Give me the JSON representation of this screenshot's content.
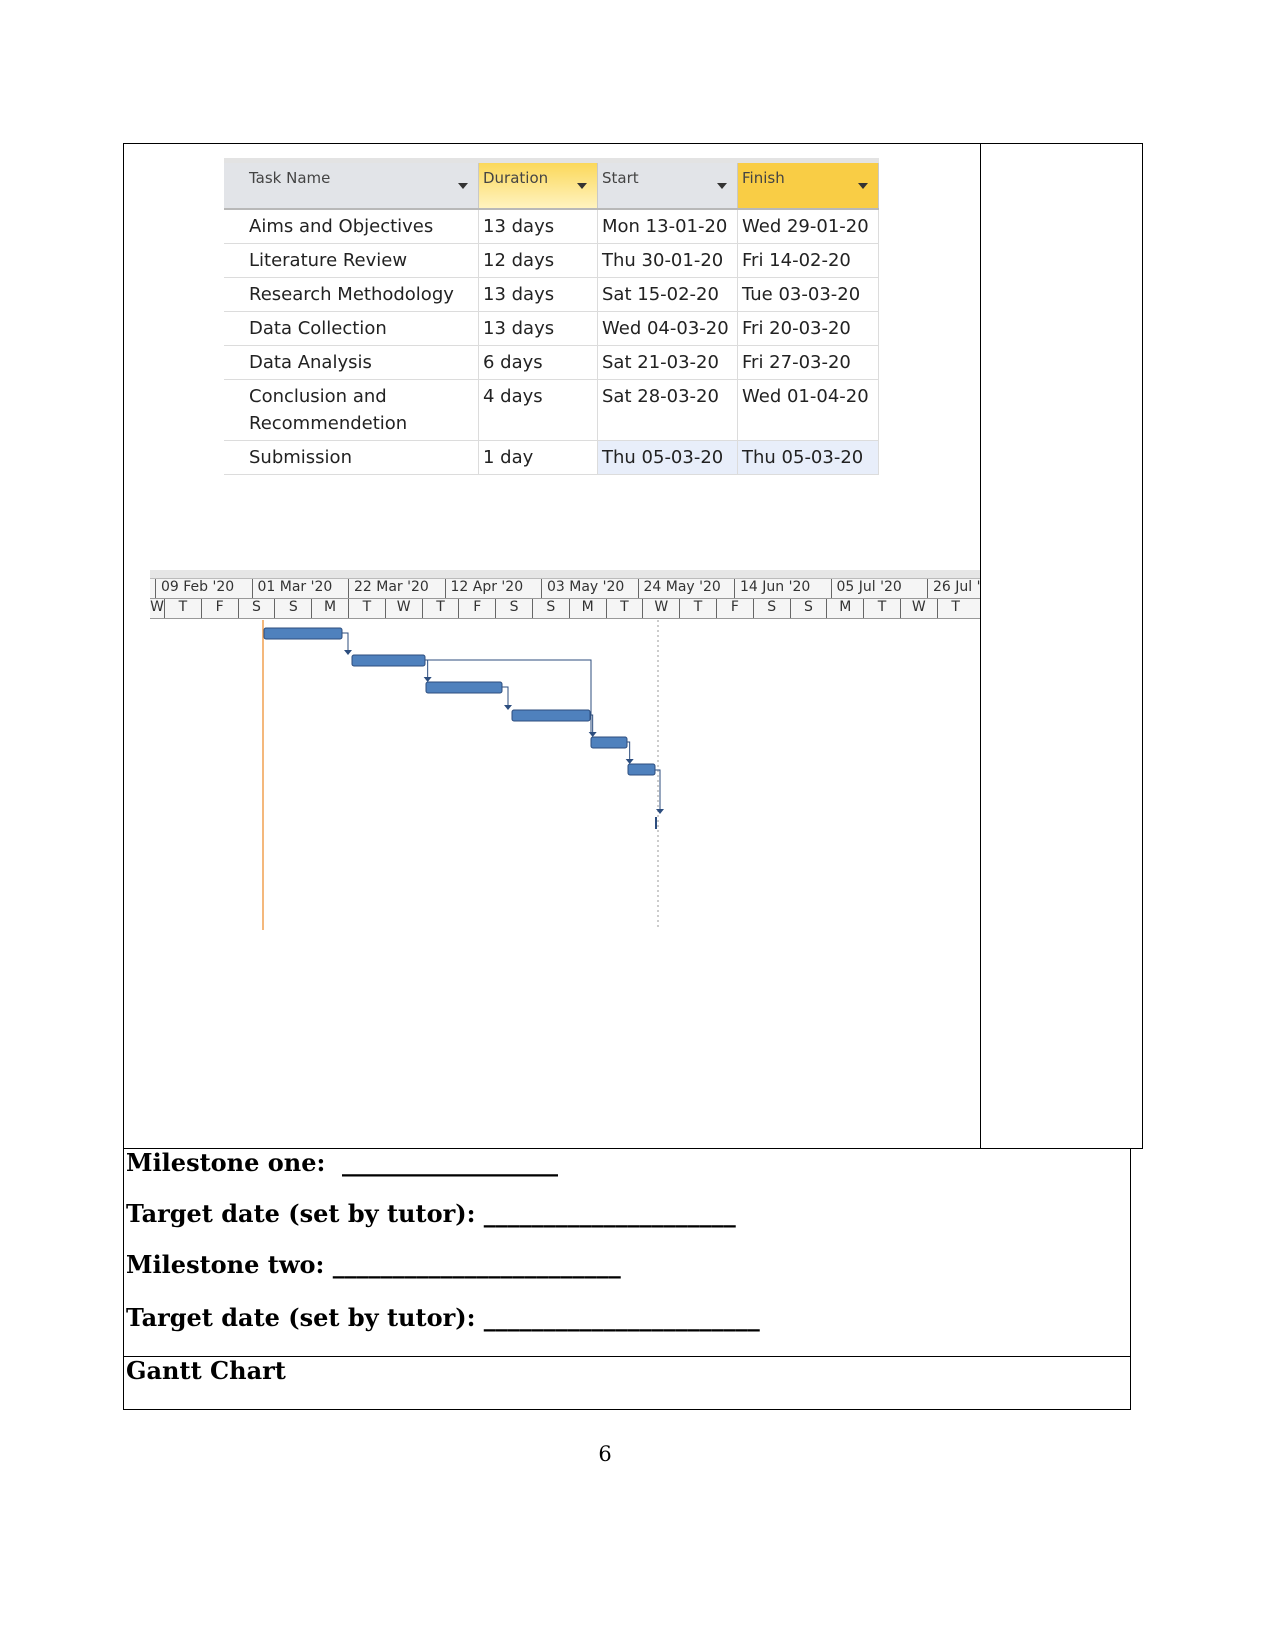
{
  "table": {
    "headers": [
      "Task Name",
      "Duration",
      "Start",
      "Finish"
    ],
    "rows": [
      {
        "name": "Aims and Objectives",
        "duration": "13 days",
        "start": "Mon 13-01-20",
        "finish": "Wed 29-01-20"
      },
      {
        "name": "Literature Review",
        "duration": "12 days",
        "start": "Thu 30-01-20",
        "finish": "Fri 14-02-20"
      },
      {
        "name": "Research Methodology",
        "duration": "13 days",
        "start": "Sat 15-02-20",
        "finish": "Tue 03-03-20"
      },
      {
        "name": "Data Collection",
        "duration": "13 days",
        "start": "Wed 04-03-20",
        "finish": "Fri 20-03-20"
      },
      {
        "name": "Data Analysis",
        "duration": "6 days",
        "start": "Sat 21-03-20",
        "finish": "Fri 27-03-20"
      },
      {
        "name": "Conclusion and Recommendetion",
        "duration": "4 days",
        "start": "Sat 28-03-20",
        "finish": "Wed 01-04-20"
      },
      {
        "name": "Submission",
        "duration": "1 day",
        "start": "Thu 05-03-20",
        "finish": "Thu 05-03-20"
      }
    ]
  },
  "timeline": {
    "major": [
      "09 Feb '20",
      "01 Mar '20",
      "22 Mar '20",
      "12 Apr '20",
      "03 May '20",
      "24 May '20",
      "14 Jun '20",
      "05 Jul '20",
      "26 Jul '"
    ],
    "minor": [
      "W",
      "T",
      "F",
      "S",
      "S",
      "M",
      "T",
      "W",
      "T",
      "F",
      "S",
      "S",
      "M",
      "T",
      "W",
      "T",
      "F",
      "S",
      "S",
      "M",
      "T",
      "W",
      "T"
    ],
    "bar_color": "#4f81bd",
    "today_line_color": "#f0a050"
  },
  "form": {
    "milestone_one": "Milestone one:  __________________",
    "target_date_1": "Target date (set by tutor): _____________________",
    "milestone_two": "Milestone two: ________________________",
    "target_date_2": "Target date (set by tutor): _______________________",
    "gantt_label": "Gantt Chart"
  },
  "page_number": "6"
}
